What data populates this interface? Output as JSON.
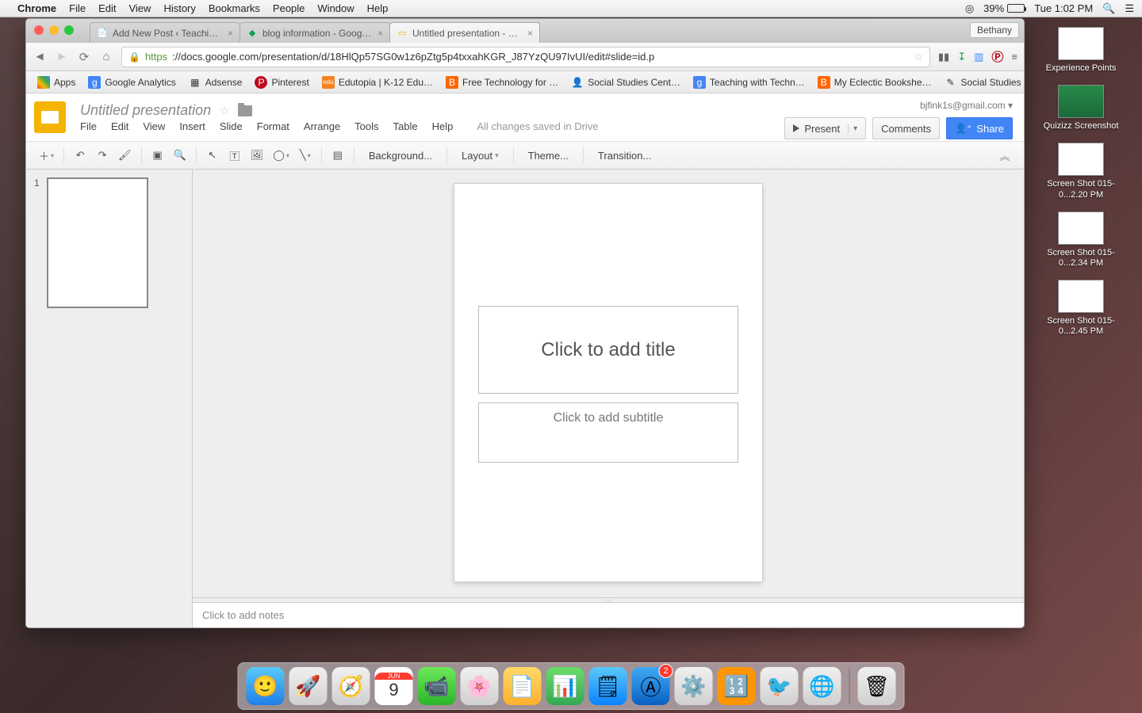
{
  "menubar": {
    "app": "Chrome",
    "items": [
      "File",
      "Edit",
      "View",
      "History",
      "Bookmarks",
      "People",
      "Window",
      "Help"
    ],
    "battery_pct": "39%",
    "clock": "Tue 1:02 PM"
  },
  "chrome": {
    "tabs": [
      {
        "title": "Add New Post ‹ Teaching w…"
      },
      {
        "title": "blog information - Google D…"
      },
      {
        "title": "Untitled presentation - Goo…"
      }
    ],
    "user_badge": "Bethany",
    "url_https": "https",
    "url_rest": "://docs.google.com/presentation/d/18HlQp57SG0w1z6pZtg5p4txxahKGR_J87YzQU97IvUI/edit#slide=id.p",
    "bookmarks": [
      {
        "label": "Apps",
        "icon": "⠿",
        "color": ""
      },
      {
        "label": "Google Analytics",
        "icon": "g",
        "bg": "#4285f4",
        "fg": "#fff"
      },
      {
        "label": "Adsense",
        "icon": "▦",
        "color": ""
      },
      {
        "label": "Pinterest",
        "icon": "P",
        "bg": "#bd081c",
        "fg": "#fff"
      },
      {
        "label": "Edutopia | K-12 Edu…",
        "icon": "edu",
        "bg": "#f58220",
        "fg": "#fff"
      },
      {
        "label": "Free Technology for …",
        "icon": "B",
        "bg": "#ff6600",
        "fg": "#fff"
      },
      {
        "label": "Social Studies Cent…",
        "icon": "👤",
        "color": ""
      },
      {
        "label": "Teaching with Techn…",
        "icon": "g",
        "bg": "#4285f4",
        "fg": "#fff"
      },
      {
        "label": "My Eclectic Bookshe…",
        "icon": "B",
        "bg": "#ff6600",
        "fg": "#fff"
      },
      {
        "label": "Social Studies CLE's",
        "icon": "✎",
        "color": ""
      }
    ]
  },
  "slides": {
    "title": "Untitled presentation",
    "menus": [
      "File",
      "Edit",
      "View",
      "Insert",
      "Slide",
      "Format",
      "Arrange",
      "Tools",
      "Table",
      "Help"
    ],
    "saved": "All changes saved in Drive",
    "email": "bjfink1s@gmail.com ▾",
    "present": "Present",
    "comments": "Comments",
    "share": "Share",
    "toolbar_text": {
      "bg": "Background...",
      "layout": "Layout",
      "theme": "Theme...",
      "transition": "Transition..."
    },
    "thumb_num": "1",
    "title_placeholder": "Click to add title",
    "subtitle_placeholder": "Click to add subtitle",
    "notes_placeholder": "Click to add notes"
  },
  "desktop": {
    "files": [
      "Experience Points",
      "Quizizz Screenshot",
      "Screen Shot 015-0...2.20 PM",
      "Screen Shot 015-0...2.34 PM",
      "Screen Shot 015-0...2.45 PM"
    ]
  },
  "dock": {
    "badge": "2",
    "cal_month": "JUN",
    "cal_day": "9"
  }
}
